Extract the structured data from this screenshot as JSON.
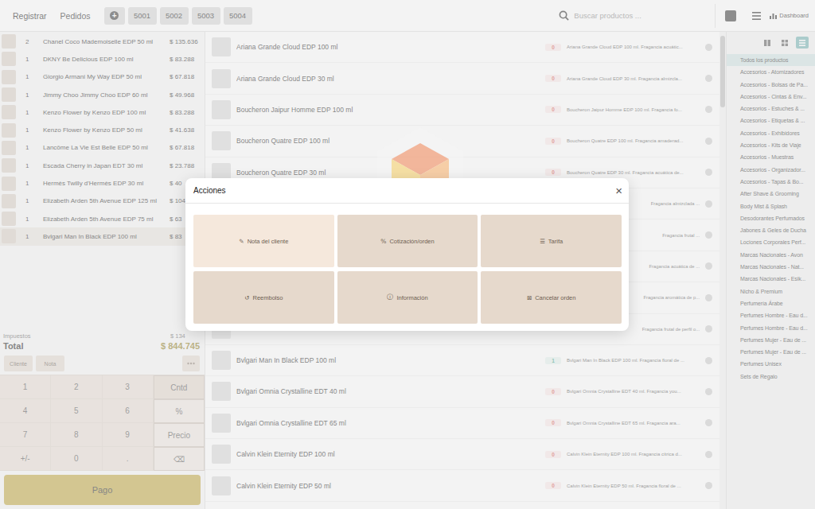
{
  "topbar": {
    "nav": [
      {
        "label": "Registrar",
        "selected": true
      },
      {
        "label": "Pedidos",
        "selected": false
      }
    ],
    "new_order": "+",
    "orders": [
      {
        "label": "5001",
        "selected": false
      },
      {
        "label": "5002",
        "selected": false
      },
      {
        "label": "5003",
        "selected": false
      },
      {
        "label": "5004",
        "selected": false
      }
    ],
    "search": {
      "placeholder": "Buscar productos ..."
    },
    "dashboard": "Dashboard"
  },
  "order": {
    "lines": [
      {
        "qty": "2",
        "name": "Chanel Coco Mademoiselle EDP 50 ml",
        "price": "$ 135.636",
        "selected": false
      },
      {
        "qty": "1",
        "name": "DKNY Be Delicious EDP 100 ml",
        "price": "$ 83.288",
        "selected": false
      },
      {
        "qty": "1",
        "name": "Giorgio Armani My Way EDP 50 ml",
        "price": "$ 67.818",
        "selected": false
      },
      {
        "qty": "1",
        "name": "Jimmy Choo Jimmy Choo EDP 60 ml",
        "price": "$ 49.968",
        "selected": false
      },
      {
        "qty": "1",
        "name": "Kenzo Flower by Kenzo EDP 100 ml",
        "price": "$ 83.288",
        "selected": false
      },
      {
        "qty": "1",
        "name": "Kenzo Flower by Kenzo EDP 50 ml",
        "price": "$ 41.638",
        "selected": false
      },
      {
        "qty": "1",
        "name": "Lancôme La Vie Est Belle EDP 50 ml",
        "price": "$ 67.818",
        "selected": false
      },
      {
        "qty": "1",
        "name": "Escada Cherry in Japan EDT 30 ml",
        "price": "$ 23.788",
        "selected": false
      },
      {
        "qty": "1",
        "name": "Hermès Twilly d'Hermès EDP 30 ml",
        "price": "$ 40",
        "selected": false
      },
      {
        "qty": "1",
        "name": "Elizabeth Arden 5th Avenue EDP 125 ml",
        "price": "$ 104",
        "selected": false
      },
      {
        "qty": "1",
        "name": "Elizabeth Arden 5th Avenue EDP 75 ml",
        "price": "$ 63",
        "selected": false
      },
      {
        "qty": "1",
        "name": "Bvlgari Man In Black EDP 100 ml",
        "price": "$ 83",
        "selected": true
      }
    ],
    "taxes_label": "Impuestos",
    "taxes": "$ 134",
    "total_label": "Total",
    "total": "$ 844.745",
    "buttons": [
      "Cliente",
      "Nota"
    ],
    "keys": [
      {
        "label": "1",
        "kind": "digit",
        "selected": false
      },
      {
        "label": "2",
        "kind": "digit",
        "selected": false
      },
      {
        "label": "3",
        "kind": "digit",
        "selected": false
      },
      {
        "label": "Cntd",
        "kind": "mode",
        "selected": true
      },
      {
        "label": "4",
        "kind": "digit",
        "selected": false
      },
      {
        "label": "5",
        "kind": "digit",
        "selected": false
      },
      {
        "label": "6",
        "kind": "digit",
        "selected": false
      },
      {
        "label": "%",
        "kind": "mode",
        "selected": false
      },
      {
        "label": "7",
        "kind": "digit",
        "selected": false
      },
      {
        "label": "8",
        "kind": "digit",
        "selected": false
      },
      {
        "label": "9",
        "kind": "digit",
        "selected": false
      },
      {
        "label": "Precio",
        "kind": "mode",
        "selected": false
      },
      {
        "label": "+/-",
        "kind": "digit",
        "selected": false
      },
      {
        "label": "0",
        "kind": "digit",
        "selected": false
      },
      {
        "label": ".",
        "kind": "digit",
        "selected": false
      },
      {
        "label": "⌫",
        "kind": "mode",
        "selected": false
      }
    ],
    "pay": "Pago"
  },
  "products": [
    {
      "kind": "row",
      "name": "Ariana Grande Cloud EDP 100 ml",
      "stock": "0",
      "color": "#d9534f",
      "desc": "Ariana Grande Cloud EDP 100 ml. Fragancia acuátic..."
    },
    {
      "kind": "row",
      "name": "Ariana Grande Cloud EDP 30 ml",
      "stock": "0",
      "color": "#d9534f",
      "desc": "Ariana Grande Cloud EDP 30 ml. Fragancia almizcla..."
    },
    {
      "kind": "row",
      "name": "Boucheron Jaipur Homme EDP 100 ml",
      "stock": "0",
      "color": "#d9534f",
      "desc": "Boucheron Jaipur Homme EDP 100 ml. Fragancia fo..."
    },
    {
      "kind": "row",
      "name": "Boucheron Quatre EDP 100 ml",
      "stock": "0",
      "color": "#d9534f",
      "desc": "Boucheron Quatre EDP 100 ml. Fragancia amaderad..."
    },
    {
      "kind": "row",
      "name": "Boucheron Quatre EDP 30 ml",
      "stock": "0",
      "color": "#d9534f",
      "desc": "Boucheron Quatre EDP 30 ml. Fragancia acuática de..."
    },
    {
      "kind": "covered",
      "name": "",
      "stock": "",
      "color": "#d9534f",
      "desc": "Fragancia almizclada ..."
    },
    {
      "kind": "covered",
      "name": "",
      "stock": "",
      "color": "#d9534f",
      "desc": "Fragancia frutal ..."
    },
    {
      "kind": "covered",
      "name": "",
      "stock": "",
      "color": "#d9534f",
      "desc": "Fragancia acuática de ..."
    },
    {
      "kind": "covered",
      "name": "",
      "stock": "",
      "color": "#d9534f",
      "desc": "Fragancia aromática de p..."
    },
    {
      "kind": "covered",
      "name": "",
      "stock": "",
      "color": "#d9534f",
      "desc": "Fragancia frutal de perfil o..."
    },
    {
      "kind": "row",
      "name": "Bvlgari Man In Black EDP 100 ml",
      "stock": "1",
      "color": "#3a9f86",
      "desc": "Bvlgari Man In Black EDP 100 ml. Fragancia floral de ..."
    },
    {
      "kind": "row",
      "name": "Bvlgari Omnia Crystalline EDT 40 ml",
      "stock": "0",
      "color": "#d9534f",
      "desc": "Bvlgari Omnia Crystalline EDT 40 ml. Fragancia you..."
    },
    {
      "kind": "row",
      "name": "Bvlgari Omnia Crystalline EDT 65 ml",
      "stock": "0",
      "color": "#d9534f",
      "desc": "Bvlgari Omnia Crystalline EDT 65 ml. Fragancia ara..."
    },
    {
      "kind": "row",
      "name": "Calvin Klein Eternity EDP 100 ml",
      "stock": "0",
      "color": "#d9534f",
      "desc": "Calvin Klein Eternity EDP 100 ml. Fragancia cítrica d..."
    },
    {
      "kind": "row",
      "name": "Calvin Klein Eternity EDP 50 ml",
      "stock": "0",
      "color": "#d9534f",
      "desc": "Calvin Klein Eternity EDP 50 ml. Fragancia floral de ..."
    }
  ],
  "view_modes": [
    {
      "kind": "large-grid",
      "selected": false
    },
    {
      "kind": "small-grid",
      "selected": false
    },
    {
      "kind": "list",
      "selected": true
    }
  ],
  "categories": [
    {
      "label": "Todos los productos",
      "selected": true
    },
    {
      "label": "Accesorios - Atomizadores",
      "selected": false
    },
    {
      "label": "Accesorios - Bolsas de Pa...",
      "selected": false
    },
    {
      "label": "Accesorios - Cintas & Env...",
      "selected": false
    },
    {
      "label": "Accesorios - Estuches & ...",
      "selected": false
    },
    {
      "label": "Accesorios - Etiquetas & ...",
      "selected": false
    },
    {
      "label": "Accesorios - Exhibidores",
      "selected": false
    },
    {
      "label": "Accesorios - Kits de Viaje",
      "selected": false
    },
    {
      "label": "Accesorios - Muestras",
      "selected": false
    },
    {
      "label": "Accesorios - Organizador...",
      "selected": false
    },
    {
      "label": "Accesorios - Tapas & Bo...",
      "selected": false
    },
    {
      "label": "After Shave & Grooming",
      "selected": false
    },
    {
      "label": "Body Mist & Splash",
      "selected": false
    },
    {
      "label": "Desodorantes Perfumados",
      "selected": false
    },
    {
      "label": "Jabones & Geles de Ducha",
      "selected": false
    },
    {
      "label": "Lociones Corporales Perf...",
      "selected": false
    },
    {
      "label": "Marcas Nacionales - Avon",
      "selected": false
    },
    {
      "label": "Marcas Nacionales - Nat...",
      "selected": false
    },
    {
      "label": "Marcas Nacionales - Esik...",
      "selected": false
    },
    {
      "label": "Nicho & Premium",
      "selected": false
    },
    {
      "label": "Perfumería Árabe",
      "selected": false
    },
    {
      "label": "Perfumes Hombre - Eau d...",
      "selected": false
    },
    {
      "label": "Perfumes Hombre - Eau d...",
      "selected": false
    },
    {
      "label": "Perfumes Mujer - Eau de ...",
      "selected": false
    },
    {
      "label": "Perfumes Mujer - Eau de ...",
      "selected": false
    },
    {
      "label": "Perfumes Unisex",
      "selected": false
    },
    {
      "label": "Sets de Regalo",
      "selected": false
    }
  ],
  "modal": {
    "title": "Acciones",
    "close": "×",
    "actions": [
      {
        "icon": "✎",
        "label": "Nota del cliente",
        "highlighted": true
      },
      {
        "icon": "%",
        "label": "Cotización/orden",
        "highlighted": false
      },
      {
        "icon": "☰",
        "label": "Tarifa",
        "highlighted": false
      },
      {
        "icon": "↺",
        "label": "Reembolso",
        "highlighted": false
      },
      {
        "icon": "ⓘ",
        "label": "Información",
        "highlighted": false
      },
      {
        "icon": "⊠",
        "label": "Cancelar orden",
        "highlighted": false
      }
    ]
  }
}
